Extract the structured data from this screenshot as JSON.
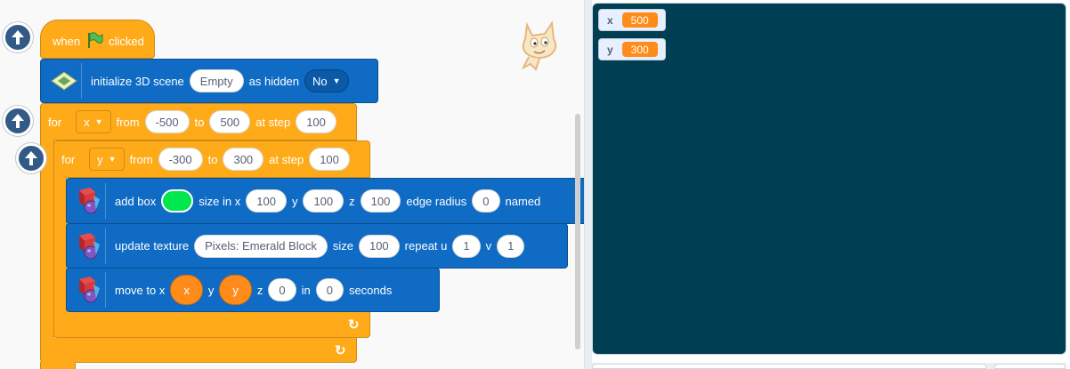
{
  "hat": {
    "when": "when",
    "clicked": "clicked",
    "flag_icon": "green-flag-icon"
  },
  "init_scene": {
    "label": "initialize 3D scene",
    "scene": "Empty",
    "hidden_label": "as hidden",
    "hidden_value": "No"
  },
  "for_x": {
    "for": "for",
    "var": "x",
    "from": "from",
    "from_value": "-500",
    "to": "to",
    "to_value": "500",
    "step": "at step",
    "step_value": "100"
  },
  "for_y": {
    "for": "for",
    "var": "y",
    "from": "from",
    "from_value": "-300",
    "to": "to",
    "to_value": "300",
    "step": "at step",
    "step_value": "100"
  },
  "add_box": {
    "label": "add box",
    "color": "#00e64d",
    "size_label": "size in x",
    "size_x": "100",
    "y_label": "y",
    "size_y": "100",
    "z_label": "z",
    "size_z": "100",
    "radius_label": "edge radius",
    "radius": "0",
    "named": "named"
  },
  "update_texture": {
    "label": "update texture",
    "texture": "Pixels: Emerald Block",
    "size_label": "size",
    "size": "100",
    "repeat_label": "repeat u",
    "u": "1",
    "v_label": "v",
    "v": "1"
  },
  "move_to": {
    "label": "move to x",
    "x": "x",
    "y_label": "y",
    "y": "y",
    "z_label": "z",
    "z": "0",
    "in_label": "in",
    "in": "0",
    "seconds": "seconds"
  },
  "monitors": [
    {
      "label": "x",
      "value": "500"
    },
    {
      "label": "y",
      "value": "300"
    }
  ],
  "colors": {
    "control": "#ffab19",
    "extension": "#0f6bc4",
    "variable": "#ff8c1a",
    "stage": "#003e54"
  }
}
